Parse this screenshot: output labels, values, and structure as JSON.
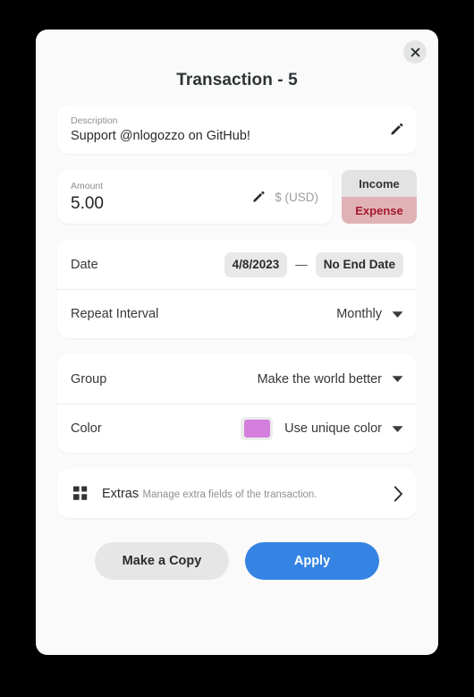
{
  "window": {
    "title": "Transaction - 5",
    "close_label": "×",
    "accent_color": "#3584e4",
    "background_color": "#fafafa"
  },
  "description": {
    "label": "Description",
    "value": "Support @nlogozzo on GitHub!",
    "edit_icon": "pencil-icon"
  },
  "amount": {
    "label": "Amount",
    "value": "5.00",
    "currency": "$ (USD)",
    "edit_icon": "pencil-icon",
    "type_toggle": {
      "income_label": "Income",
      "expense_label": "Expense",
      "selected": "Expense",
      "income_bg": "#e3e3e3",
      "expense_bg": "#e0b2b6",
      "expense_text": "#a4192c"
    }
  },
  "schedule": {
    "date": {
      "label": "Date",
      "start": "4/8/2023",
      "separator": "—",
      "end": "No End Date"
    },
    "repeat": {
      "label": "Repeat Interval",
      "value": "Monthly"
    }
  },
  "organization": {
    "group": {
      "label": "Group",
      "value": "Make the world better"
    },
    "color": {
      "label": "Color",
      "value": "Use unique color",
      "swatch_color": "#d47fdd"
    }
  },
  "extras": {
    "title": "Extras",
    "subtitle": "Manage extra fields of the transaction.",
    "icon": "grid-icon",
    "chevron": "chevron-right-icon"
  },
  "footer": {
    "copy_label": "Make a Copy",
    "apply_label": "Apply"
  }
}
